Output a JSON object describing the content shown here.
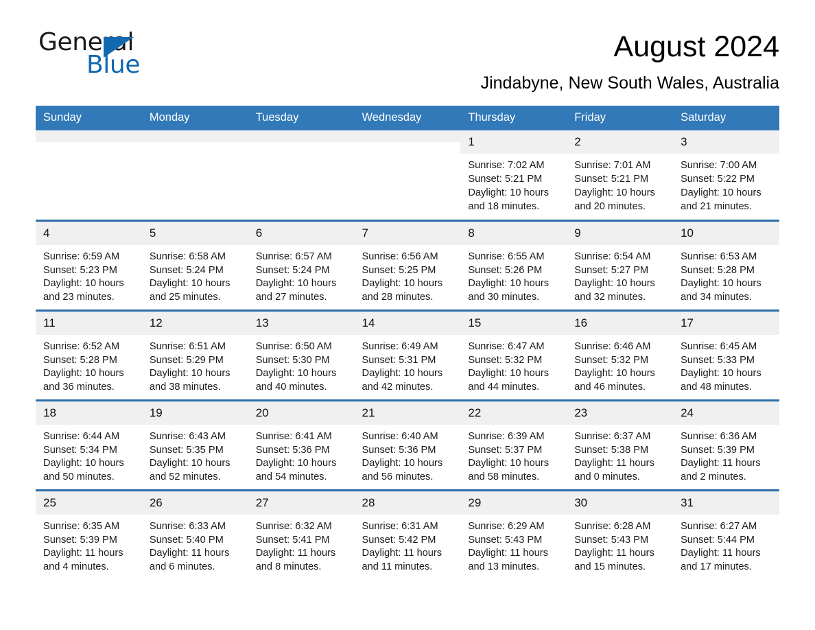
{
  "brand": {
    "name_part1": "General",
    "name_part2": "Blue",
    "triangle_icon": "triangle-icon",
    "accent_color": "#1269b0"
  },
  "header": {
    "title": "August 2024",
    "subtitle": "Jindabyne, New South Wales, Australia"
  },
  "colors": {
    "header_row": "#3179b8",
    "week_divider": "#2a6ca8",
    "daynum_strip": "#f0f0f0"
  },
  "weekday_headers": [
    "Sunday",
    "Monday",
    "Tuesday",
    "Wednesday",
    "Thursday",
    "Friday",
    "Saturday"
  ],
  "weeks": [
    [
      {
        "day": "",
        "blank": true,
        "sunrise": "",
        "sunset": "",
        "daylight_1": "",
        "daylight_2": ""
      },
      {
        "day": "",
        "blank": true,
        "sunrise": "",
        "sunset": "",
        "daylight_1": "",
        "daylight_2": ""
      },
      {
        "day": "",
        "blank": true,
        "sunrise": "",
        "sunset": "",
        "daylight_1": "",
        "daylight_2": ""
      },
      {
        "day": "",
        "blank": true,
        "sunrise": "",
        "sunset": "",
        "daylight_1": "",
        "daylight_2": ""
      },
      {
        "day": "1",
        "blank": false,
        "sunrise": "Sunrise: 7:02 AM",
        "sunset": "Sunset: 5:21 PM",
        "daylight_1": "Daylight: 10 hours",
        "daylight_2": "and 18 minutes."
      },
      {
        "day": "2",
        "blank": false,
        "sunrise": "Sunrise: 7:01 AM",
        "sunset": "Sunset: 5:21 PM",
        "daylight_1": "Daylight: 10 hours",
        "daylight_2": "and 20 minutes."
      },
      {
        "day": "3",
        "blank": false,
        "sunrise": "Sunrise: 7:00 AM",
        "sunset": "Sunset: 5:22 PM",
        "daylight_1": "Daylight: 10 hours",
        "daylight_2": "and 21 minutes."
      }
    ],
    [
      {
        "day": "4",
        "blank": false,
        "sunrise": "Sunrise: 6:59 AM",
        "sunset": "Sunset: 5:23 PM",
        "daylight_1": "Daylight: 10 hours",
        "daylight_2": "and 23 minutes."
      },
      {
        "day": "5",
        "blank": false,
        "sunrise": "Sunrise: 6:58 AM",
        "sunset": "Sunset: 5:24 PM",
        "daylight_1": "Daylight: 10 hours",
        "daylight_2": "and 25 minutes."
      },
      {
        "day": "6",
        "blank": false,
        "sunrise": "Sunrise: 6:57 AM",
        "sunset": "Sunset: 5:24 PM",
        "daylight_1": "Daylight: 10 hours",
        "daylight_2": "and 27 minutes."
      },
      {
        "day": "7",
        "blank": false,
        "sunrise": "Sunrise: 6:56 AM",
        "sunset": "Sunset: 5:25 PM",
        "daylight_1": "Daylight: 10 hours",
        "daylight_2": "and 28 minutes."
      },
      {
        "day": "8",
        "blank": false,
        "sunrise": "Sunrise: 6:55 AM",
        "sunset": "Sunset: 5:26 PM",
        "daylight_1": "Daylight: 10 hours",
        "daylight_2": "and 30 minutes."
      },
      {
        "day": "9",
        "blank": false,
        "sunrise": "Sunrise: 6:54 AM",
        "sunset": "Sunset: 5:27 PM",
        "daylight_1": "Daylight: 10 hours",
        "daylight_2": "and 32 minutes."
      },
      {
        "day": "10",
        "blank": false,
        "sunrise": "Sunrise: 6:53 AM",
        "sunset": "Sunset: 5:28 PM",
        "daylight_1": "Daylight: 10 hours",
        "daylight_2": "and 34 minutes."
      }
    ],
    [
      {
        "day": "11",
        "blank": false,
        "sunrise": "Sunrise: 6:52 AM",
        "sunset": "Sunset: 5:28 PM",
        "daylight_1": "Daylight: 10 hours",
        "daylight_2": "and 36 minutes."
      },
      {
        "day": "12",
        "blank": false,
        "sunrise": "Sunrise: 6:51 AM",
        "sunset": "Sunset: 5:29 PM",
        "daylight_1": "Daylight: 10 hours",
        "daylight_2": "and 38 minutes."
      },
      {
        "day": "13",
        "blank": false,
        "sunrise": "Sunrise: 6:50 AM",
        "sunset": "Sunset: 5:30 PM",
        "daylight_1": "Daylight: 10 hours",
        "daylight_2": "and 40 minutes."
      },
      {
        "day": "14",
        "blank": false,
        "sunrise": "Sunrise: 6:49 AM",
        "sunset": "Sunset: 5:31 PM",
        "daylight_1": "Daylight: 10 hours",
        "daylight_2": "and 42 minutes."
      },
      {
        "day": "15",
        "blank": false,
        "sunrise": "Sunrise: 6:47 AM",
        "sunset": "Sunset: 5:32 PM",
        "daylight_1": "Daylight: 10 hours",
        "daylight_2": "and 44 minutes."
      },
      {
        "day": "16",
        "blank": false,
        "sunrise": "Sunrise: 6:46 AM",
        "sunset": "Sunset: 5:32 PM",
        "daylight_1": "Daylight: 10 hours",
        "daylight_2": "and 46 minutes."
      },
      {
        "day": "17",
        "blank": false,
        "sunrise": "Sunrise: 6:45 AM",
        "sunset": "Sunset: 5:33 PM",
        "daylight_1": "Daylight: 10 hours",
        "daylight_2": "and 48 minutes."
      }
    ],
    [
      {
        "day": "18",
        "blank": false,
        "sunrise": "Sunrise: 6:44 AM",
        "sunset": "Sunset: 5:34 PM",
        "daylight_1": "Daylight: 10 hours",
        "daylight_2": "and 50 minutes."
      },
      {
        "day": "19",
        "blank": false,
        "sunrise": "Sunrise: 6:43 AM",
        "sunset": "Sunset: 5:35 PM",
        "daylight_1": "Daylight: 10 hours",
        "daylight_2": "and 52 minutes."
      },
      {
        "day": "20",
        "blank": false,
        "sunrise": "Sunrise: 6:41 AM",
        "sunset": "Sunset: 5:36 PM",
        "daylight_1": "Daylight: 10 hours",
        "daylight_2": "and 54 minutes."
      },
      {
        "day": "21",
        "blank": false,
        "sunrise": "Sunrise: 6:40 AM",
        "sunset": "Sunset: 5:36 PM",
        "daylight_1": "Daylight: 10 hours",
        "daylight_2": "and 56 minutes."
      },
      {
        "day": "22",
        "blank": false,
        "sunrise": "Sunrise: 6:39 AM",
        "sunset": "Sunset: 5:37 PM",
        "daylight_1": "Daylight: 10 hours",
        "daylight_2": "and 58 minutes."
      },
      {
        "day": "23",
        "blank": false,
        "sunrise": "Sunrise: 6:37 AM",
        "sunset": "Sunset: 5:38 PM",
        "daylight_1": "Daylight: 11 hours",
        "daylight_2": "and 0 minutes."
      },
      {
        "day": "24",
        "blank": false,
        "sunrise": "Sunrise: 6:36 AM",
        "sunset": "Sunset: 5:39 PM",
        "daylight_1": "Daylight: 11 hours",
        "daylight_2": "and 2 minutes."
      }
    ],
    [
      {
        "day": "25",
        "blank": false,
        "sunrise": "Sunrise: 6:35 AM",
        "sunset": "Sunset: 5:39 PM",
        "daylight_1": "Daylight: 11 hours",
        "daylight_2": "and 4 minutes."
      },
      {
        "day": "26",
        "blank": false,
        "sunrise": "Sunrise: 6:33 AM",
        "sunset": "Sunset: 5:40 PM",
        "daylight_1": "Daylight: 11 hours",
        "daylight_2": "and 6 minutes."
      },
      {
        "day": "27",
        "blank": false,
        "sunrise": "Sunrise: 6:32 AM",
        "sunset": "Sunset: 5:41 PM",
        "daylight_1": "Daylight: 11 hours",
        "daylight_2": "and 8 minutes."
      },
      {
        "day": "28",
        "blank": false,
        "sunrise": "Sunrise: 6:31 AM",
        "sunset": "Sunset: 5:42 PM",
        "daylight_1": "Daylight: 11 hours",
        "daylight_2": "and 11 minutes."
      },
      {
        "day": "29",
        "blank": false,
        "sunrise": "Sunrise: 6:29 AM",
        "sunset": "Sunset: 5:43 PM",
        "daylight_1": "Daylight: 11 hours",
        "daylight_2": "and 13 minutes."
      },
      {
        "day": "30",
        "blank": false,
        "sunrise": "Sunrise: 6:28 AM",
        "sunset": "Sunset: 5:43 PM",
        "daylight_1": "Daylight: 11 hours",
        "daylight_2": "and 15 minutes."
      },
      {
        "day": "31",
        "blank": false,
        "sunrise": "Sunrise: 6:27 AM",
        "sunset": "Sunset: 5:44 PM",
        "daylight_1": "Daylight: 11 hours",
        "daylight_2": "and 17 minutes."
      }
    ]
  ]
}
